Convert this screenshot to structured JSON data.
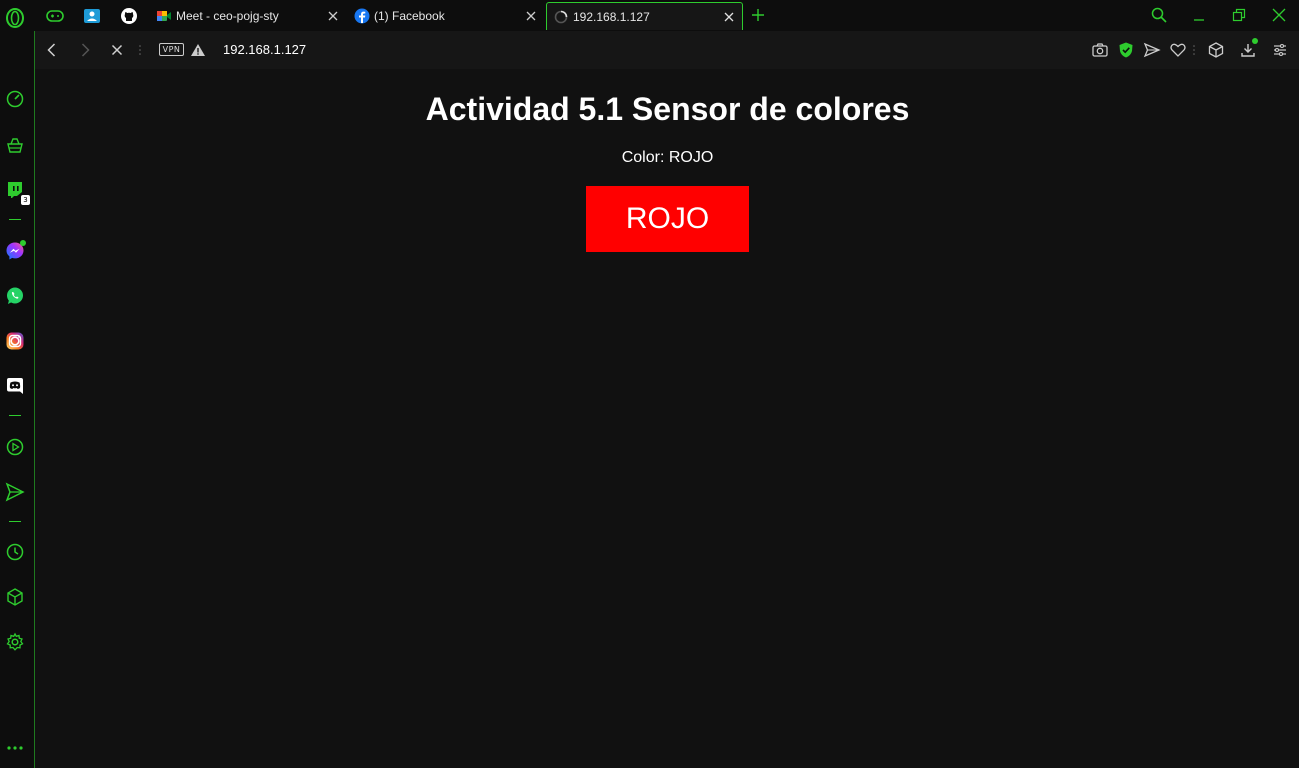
{
  "tabs": [
    {
      "label": "Meet - ceo-pojg-sty",
      "icon": "google-meet-icon"
    },
    {
      "label": "(1) Facebook",
      "icon": "facebook-icon"
    },
    {
      "label": "192.168.1.127",
      "icon": "loading-spinner-icon",
      "active": true
    }
  ],
  "address_bar": {
    "url": "192.168.1.127",
    "vpn_label": "VPN"
  },
  "sidebar": {
    "twitch_badge": "3"
  },
  "page": {
    "heading": "Actividad 5.1 Sensor de colores",
    "status_text": "Color: ROJO",
    "color_box_label": "ROJO",
    "color_box_color": "#ff0000"
  },
  "colors": {
    "accent": "#2ecc2e",
    "background": "#111111"
  }
}
